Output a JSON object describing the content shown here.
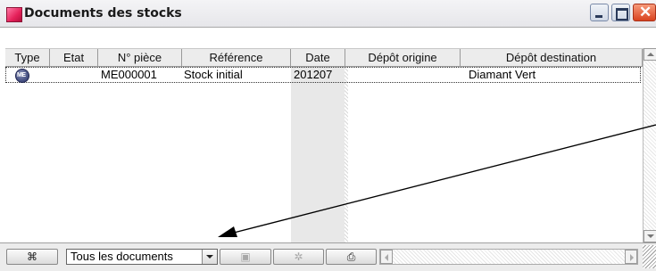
{
  "window": {
    "title": "Documents des stocks",
    "accent_color": "#e5205a"
  },
  "table": {
    "columns": [
      "Type",
      "Etat",
      "N° pièce",
      "Référence",
      "Date",
      "Dépôt origine",
      "Dépôt destination"
    ],
    "rows": [
      {
        "type_icon": "ME",
        "etat": "",
        "numero": "ME000001",
        "reference": "Stock initial",
        "date": "201207",
        "depot_origine": "",
        "depot_destination": "Diamant Vert"
      }
    ]
  },
  "toolbar": {
    "filter_value": "Tous les documents",
    "buttons": [
      "binoculars-icon",
      "transfer-icon",
      "gear-icon",
      "print-icon"
    ]
  }
}
